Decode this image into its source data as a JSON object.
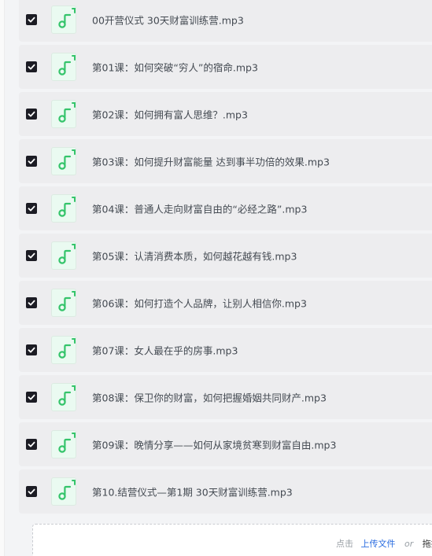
{
  "colors": {
    "checkbox": "#1c1c24",
    "icon_green": "#35c46b",
    "row_bg": "#ededef",
    "link": "#2b6de0"
  },
  "files": [
    {
      "name": "00开营仪式 30天财富训练营.mp3",
      "checked": true,
      "icon": "music-note-icon"
    },
    {
      "name": "第01课：如何突破“穷人”的宿命.mp3",
      "checked": true,
      "icon": "music-note-icon"
    },
    {
      "name": "第02课：如何拥有富人思维？.mp3",
      "checked": true,
      "icon": "music-note-icon"
    },
    {
      "name": "第03课：如何提升财富能量 达到事半功倍的效果.mp3",
      "checked": true,
      "icon": "music-note-icon"
    },
    {
      "name": "第04课：普通人走向财富自由的“必经之路”.mp3",
      "checked": true,
      "icon": "music-note-icon"
    },
    {
      "name": "第05课：认清消费本质，如何越花越有钱.mp3",
      "checked": true,
      "icon": "music-note-icon"
    },
    {
      "name": "第06课：如何打造个人品牌，让别人相信你.mp3",
      "checked": true,
      "icon": "music-note-icon"
    },
    {
      "name": "第07课：女人最在乎的房事.mp3",
      "checked": true,
      "icon": "music-note-icon"
    },
    {
      "name": "第08课：保卫你的财富，如何把握婚姻共同财产.mp3",
      "checked": true,
      "icon": "music-note-icon"
    },
    {
      "name": "第09课：晚情分享——如何从家境贫寒到财富自由.mp3",
      "checked": true,
      "icon": "music-note-icon"
    },
    {
      "name": "第10.结营仪式—第1期 30天财富训练营.mp3",
      "checked": true,
      "icon": "music-note-icon"
    }
  ],
  "upload": {
    "prefix": "点击",
    "link": "上传文件",
    "or": "or",
    "suffix": "拖拽"
  }
}
